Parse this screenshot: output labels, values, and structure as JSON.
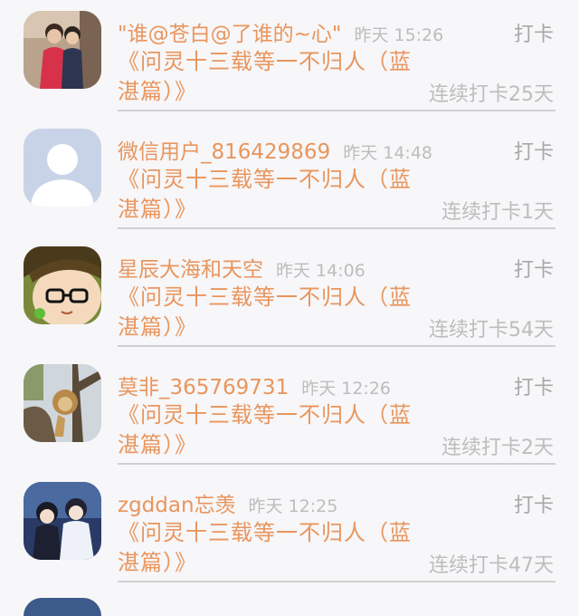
{
  "items": [
    {
      "name": "\"谁@苍白@了谁的~心\"",
      "time": "昨天 15:26",
      "action": "打卡",
      "book": "《问灵十三载等一不归人（蓝湛篇）》",
      "streak": "连续打卡25天",
      "avatar": "photo-two-children-avatar"
    },
    {
      "name": "微信用户_816429869",
      "time": "昨天 14:48",
      "action": "打卡",
      "book": "《问灵十三载等一不归人（蓝湛篇）》",
      "streak": "连续打卡1天",
      "avatar": "default-user-avatar"
    },
    {
      "name": "星辰大海和天空",
      "time": "昨天 14:06",
      "action": "打卡",
      "book": "《问灵十三载等一不归人（蓝湛篇）》",
      "streak": "连续打卡54天",
      "avatar": "cartoon-face-avatar"
    },
    {
      "name": "莫非_365769731",
      "time": "昨天 12:26",
      "action": "打卡",
      "book": "《问灵十三载等一不归人（蓝湛篇）》",
      "streak": "连续打卡2天",
      "avatar": "lion-in-tree-avatar"
    },
    {
      "name": "zgddan忘羡",
      "time": "昨天 12:25",
      "action": "打卡",
      "book": "《问灵十三载等一不归人（蓝湛篇）》",
      "streak": "连续打卡47天",
      "avatar": "anime-characters-avatar"
    }
  ],
  "colors": {
    "accent": "#e8965e",
    "muted": "#bdbdbd",
    "action": "#a8a8a8",
    "background": "#f7f6f8"
  }
}
